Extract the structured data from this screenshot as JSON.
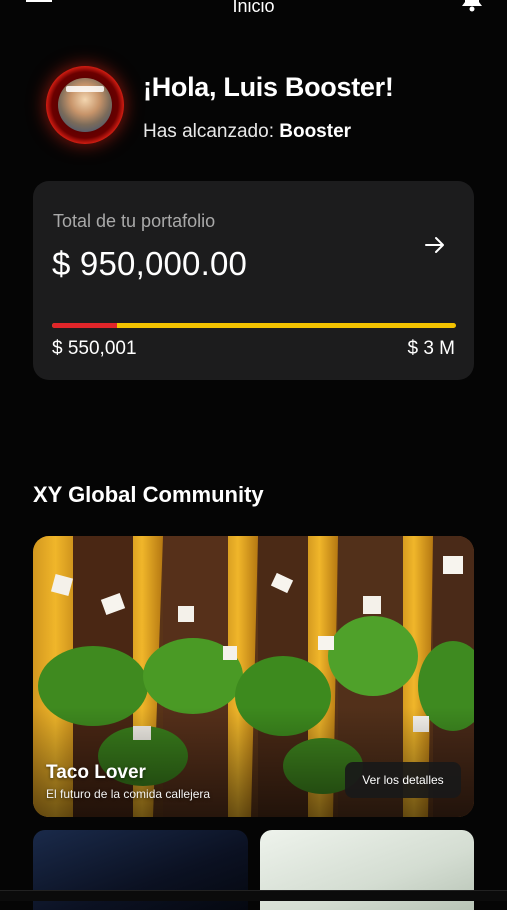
{
  "header": {
    "title": "Inicio",
    "menu_icon": "hamburger-menu-icon",
    "bell_icon": "bell-icon"
  },
  "profile": {
    "greeting": "¡Hola, Luis Booster!",
    "level_prefix": "Has alcanzado: ",
    "level_name": "Booster"
  },
  "portfolio": {
    "label": "Total de tu portafolio",
    "amount": "$ 950,000.00",
    "progress_fraction": 0.16,
    "range_min": "$ 550,001",
    "range_max": "$ 3 M",
    "bar_color_progress": "#e0252a",
    "bar_color_track": "#f2c200"
  },
  "community": {
    "title": "XY Global Community",
    "featured": {
      "title": "Taco Lover",
      "subtitle": "El futuro de la comida callejera",
      "button_label": "Ver los detalles"
    }
  }
}
